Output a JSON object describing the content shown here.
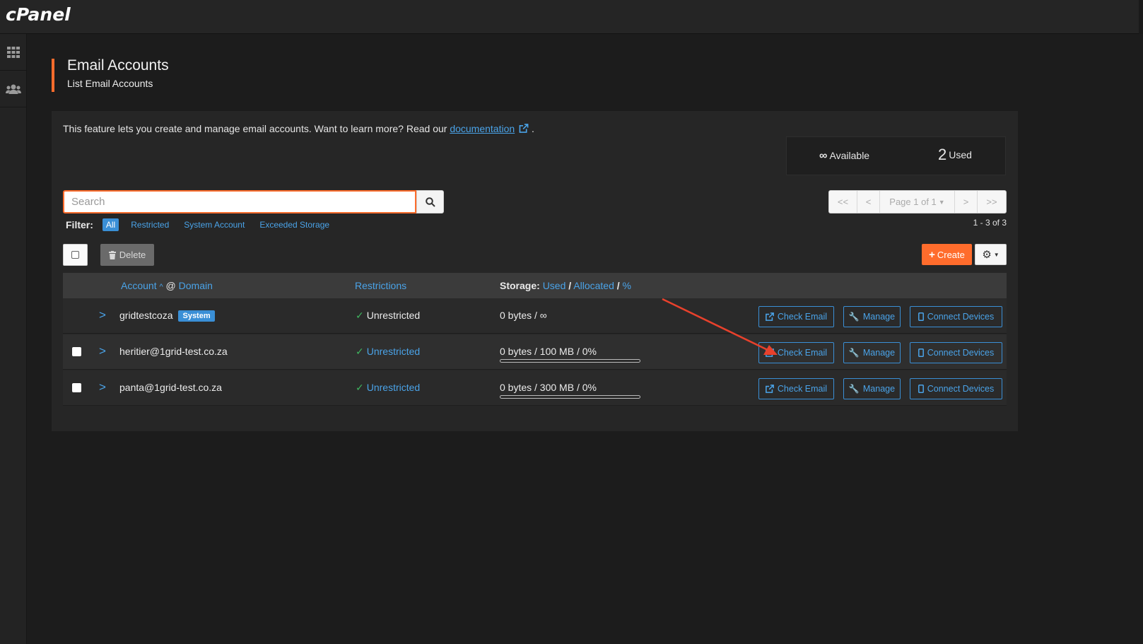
{
  "app": {
    "logo": "cPanel"
  },
  "header": {
    "title": "Email Accounts",
    "subtitle": "List Email Accounts"
  },
  "intro": {
    "text": "This feature lets you create and manage email accounts. Want to learn more? Read our ",
    "link": "documentation",
    "suffix": "."
  },
  "stats": {
    "available_symbol": "∞",
    "available_label": "Available",
    "used_count": "2",
    "used_label": "Used"
  },
  "search": {
    "placeholder": "Search"
  },
  "filter": {
    "label": "Filter:",
    "all": "All",
    "options": [
      "Restricted",
      "System Account",
      "Exceeded Storage"
    ]
  },
  "pagination": {
    "first": "<<",
    "prev": "<",
    "page": "Page 1 of 1",
    "next": ">",
    "last": ">>",
    "count": "1 - 3 of 3"
  },
  "toolbar": {
    "delete_label": "Delete",
    "create_label": "Create"
  },
  "table": {
    "headers": {
      "account": "Account",
      "at": "@",
      "domain": "Domain",
      "restrictions": "Restrictions",
      "storage_label": "Storage:",
      "used": "Used",
      "allocated": "Allocated",
      "percent": "%",
      "sep": "/"
    },
    "rows": [
      {
        "account": "gridtestcoza",
        "badge": "System",
        "restriction": "Unrestricted",
        "storage": "0 bytes / ∞",
        "usage": 0,
        "check": "Check Email",
        "manage": "Manage",
        "connect": "Connect Devices"
      },
      {
        "account": "heritier@1grid-test.co.za",
        "restriction": "Unrestricted",
        "storage": "0 bytes / 100 MB / 0%",
        "usage": 0,
        "check": "Check Email",
        "manage": "Manage",
        "connect": "Connect Devices"
      },
      {
        "account": "panta@1grid-test.co.za",
        "restriction": "Unrestricted",
        "storage": "0 bytes / 300 MB / 0%",
        "usage": 0,
        "check": "Check Email",
        "manage": "Manage",
        "connect": "Connect Devices"
      }
    ]
  },
  "colors": {
    "accent": "#ff6c2c",
    "link": "#4aa3e8",
    "annotation_arrow": "#e8412c"
  }
}
